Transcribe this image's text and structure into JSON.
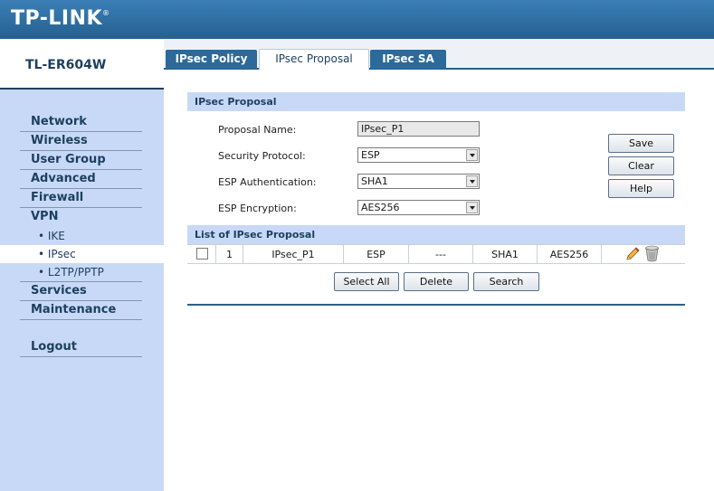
{
  "brand": {
    "logo": "TP-LINK",
    "reg": "®",
    "model": "TL-ER604W"
  },
  "nav": {
    "items": [
      {
        "label": "Network"
      },
      {
        "label": "Wireless"
      },
      {
        "label": "User Group"
      },
      {
        "label": "Advanced"
      },
      {
        "label": "Firewall"
      },
      {
        "label": "VPN"
      }
    ],
    "sub": [
      {
        "label": "• IKE"
      },
      {
        "label": "• IPsec"
      },
      {
        "label": "• L2TP/PPTP"
      }
    ],
    "after": [
      {
        "label": "Services"
      },
      {
        "label": "Maintenance"
      }
    ],
    "logout": "Logout"
  },
  "tabs": [
    "IPsec Policy",
    "IPsec Proposal",
    "IPsec SA"
  ],
  "form": {
    "section_title": "IPsec Proposal",
    "proposal_name_label": "Proposal Name:",
    "proposal_name_value": "IPsec_P1",
    "security_protocol_label": "Security Protocol:",
    "security_protocol_value": "ESP",
    "esp_auth_label": "ESP Authentication:",
    "esp_auth_value": "SHA1",
    "esp_enc_label": "ESP Encryption:",
    "esp_enc_value": "AES256",
    "save": "Save",
    "clear": "Clear",
    "help": "Help"
  },
  "list": {
    "section_title": "List of IPsec Proposal",
    "rows": [
      {
        "index": "1",
        "name": "IPsec_P1",
        "protocol": "ESP",
        "ah": "---",
        "auth": "SHA1",
        "enc": "AES256"
      }
    ],
    "select_all": "Select All",
    "delete": "Delete",
    "search": "Search"
  }
}
